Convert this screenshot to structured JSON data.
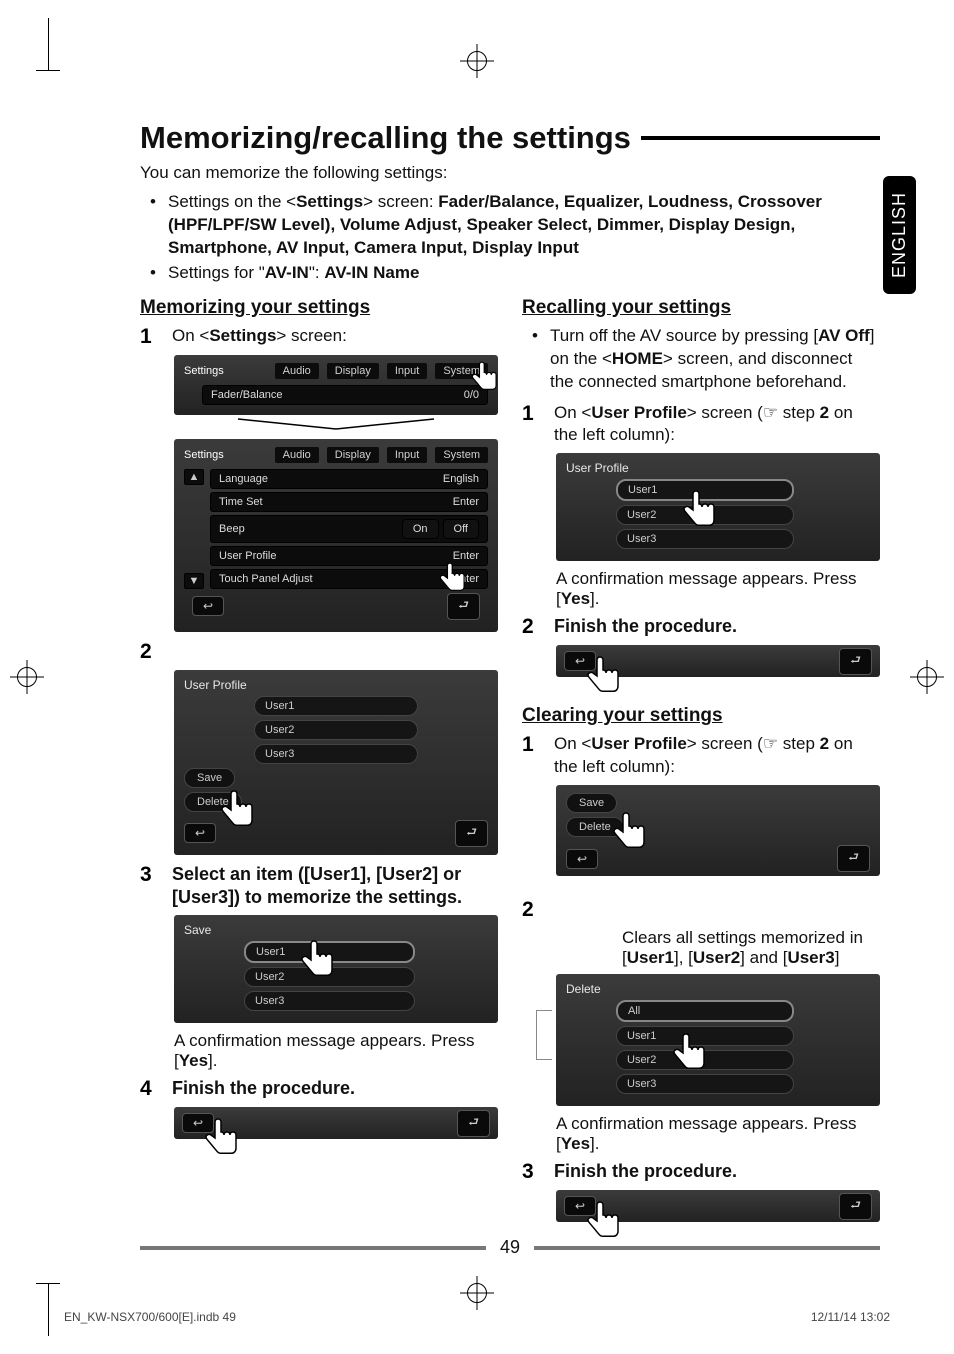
{
  "page": {
    "language_tab": "ENGLISH",
    "title": "Memorizing/recalling the settings",
    "intro": "You can memorize the following settings:",
    "bullet1_pre": "Settings on the <",
    "bullet1_settings": "Settings",
    "bullet1_post": "> screen: ",
    "bullet1_items": "Fader/Balance, Equalizer, Loudness, Crossover (HPF/LPF/SW Level), Volume Adjust, Speaker Select, Dimmer, Display Design, Smartphone, AV Input, Camera Input, Display Input",
    "bullet2_pre": "Settings for \"",
    "bullet2_avin": "AV-IN",
    "bullet2_post": "\": ",
    "bullet2_val": "AV-IN Name",
    "page_number": "49",
    "file_left": "EN_KW-NSX700/600[E].indb   49",
    "file_right": "12/11/14   13:02"
  },
  "left": {
    "heading": "Memorizing your settings",
    "step1_text_pre": "On <",
    "step1_text_b": "Settings",
    "step1_text_post": "> screen:",
    "shot1": {
      "tabs_label": "Settings",
      "tabs": [
        "Audio",
        "Display",
        "Input",
        "System"
      ],
      "row_label": "Fader/Balance",
      "row_val": "0/0"
    },
    "shot2": {
      "tabs_label": "Settings",
      "tabs": [
        "Audio",
        "Display",
        "Input",
        "System"
      ],
      "rows": [
        {
          "l": "Language",
          "r": "English"
        },
        {
          "l": "Time Set",
          "r": "Enter"
        },
        {
          "l": "Beep",
          "r": "On",
          "r2": "Off"
        },
        {
          "l": "User Profile",
          "r": "Enter"
        },
        {
          "l": "Touch Panel Adjust",
          "r": "Enter"
        }
      ]
    },
    "step2_num": "2",
    "shot3": {
      "title": "User Profile",
      "users": [
        "User1",
        "User2",
        "User3"
      ],
      "save": "Save",
      "delete": "Delete"
    },
    "step3_num": "3",
    "step3_text": "Select an item ([User1], [User2] or [User3]) to memorize the settings.",
    "shot4": {
      "title": "Save",
      "users": [
        "User1",
        "User2",
        "User3"
      ]
    },
    "confirm_text_pre": "A confirmation message appears. Press [",
    "confirm_text_b": "Yes",
    "confirm_text_post": "].",
    "step4_num": "4",
    "step4_text": "Finish the procedure."
  },
  "right": {
    "heading1": "Recalling your settings",
    "bullet_pre": "Turn off the AV source by pressing [",
    "bullet_b1": "AV Off",
    "bullet_mid": "] on the <",
    "bullet_b2": "HOME",
    "bullet_post": "> screen, and disconnect the connected smartphone beforehand.",
    "step1_num": "1",
    "step1_pre": "On <",
    "step1_b": "User Profile",
    "step1_mid": "> screen (☞ step ",
    "step1_b2": "2",
    "step1_post": " on the left column):",
    "shot1": {
      "title": "User Profile",
      "users": [
        "User1",
        "User2",
        "User3"
      ]
    },
    "confirm_text_pre": "A confirmation message appears. Press [",
    "confirm_text_b": "Yes",
    "confirm_text_post": "].",
    "step2_num": "2",
    "step2_text": "Finish the procedure.",
    "heading2": "Clearing your settings",
    "c_step1_num": "1",
    "c_step1_pre": "On <",
    "c_step1_b": "User Profile",
    "c_step1_mid": "> screen (☞ step ",
    "c_step1_b2": "2",
    "c_step1_post": " on the left column):",
    "shot2": {
      "save": "Save",
      "delete": "Delete"
    },
    "c_step2_num": "2",
    "c_step2_note_pre": "Clears all settings memorized in [",
    "c_step2_note_b1": "User1",
    "c_step2_note_mid1": "], [",
    "c_step2_note_b2": "User2",
    "c_step2_note_mid2": "] and [",
    "c_step2_note_b3": "User3",
    "c_step2_note_post": "]",
    "shot3": {
      "title": "Delete",
      "items": [
        "All",
        "User1",
        "User2",
        "User3"
      ]
    },
    "c_confirm_pre": "A confirmation message appears. Press [",
    "c_confirm_b": "Yes",
    "c_confirm_post": "].",
    "c_step3_num": "3",
    "c_step3_text": "Finish the procedure."
  }
}
